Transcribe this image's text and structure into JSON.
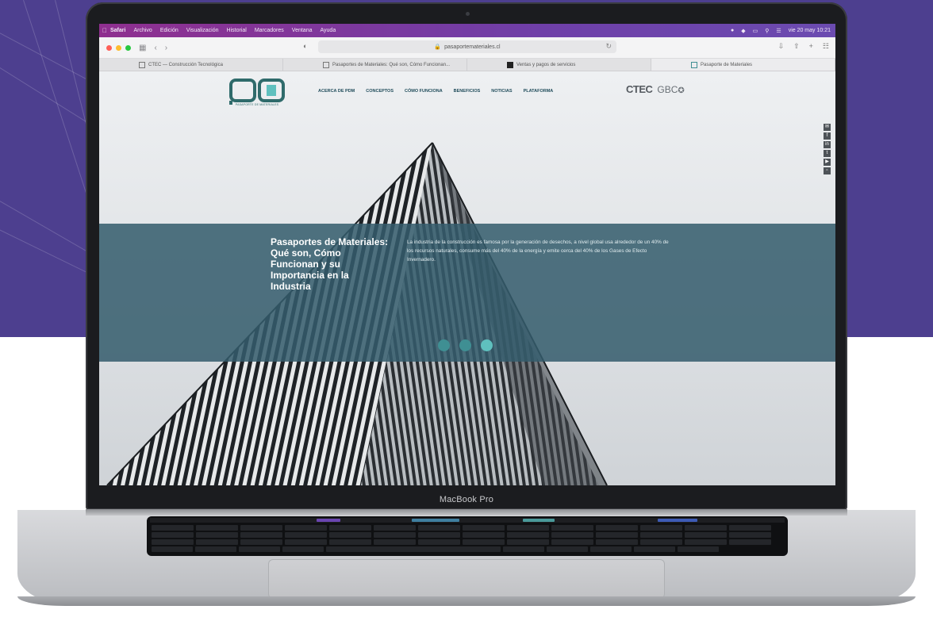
{
  "colors": {
    "background_top": "#4d3f8f",
    "menubar_gradient": [
      "#8f2f8f",
      "#6b4bb0"
    ],
    "accent_teal": "#5fc0be",
    "band": "#345c6c"
  },
  "device": {
    "label": "MacBook Pro"
  },
  "menubar": {
    "items": [
      "Safari",
      "Archivo",
      "Edición",
      "Visualización",
      "Historial",
      "Marcadores",
      "Ventana",
      "Ayuda"
    ],
    "clock": "vie 20 may 10:21"
  },
  "browser": {
    "url": "pasaportemateriales.cl",
    "tabs": [
      {
        "label": "CTEC — Construcción Tecnológica"
      },
      {
        "label": "Pasaportes de Materiales: Qué son, Cómo Funcionan..."
      },
      {
        "label": "Ventas y pagos de servicios"
      },
      {
        "label": "Pasaporte de Materiales"
      }
    ]
  },
  "site": {
    "logo_subtitle": "PASAPORTE DE MATERIALES",
    "nav": [
      "ACERCA DE PDM",
      "CONCEPTOS",
      "CÓMO FUNCIONA",
      "BENEFICIOS",
      "NOTICIAS",
      "PLATAFORMA"
    ],
    "partners": [
      "CTEC",
      "GBC"
    ],
    "social_icons": [
      "mail-icon",
      "facebook-icon",
      "linkedin-icon",
      "twitter-icon",
      "youtube-icon",
      "email-icon"
    ],
    "hero": {
      "title": "Pasaportes de Materiales: Qué son, Cómo Funcionan y su Importancia en la Industria",
      "text": "La industria de la construcción es famosa por la generación de desechos, a nivel global usa alrededor de un 40% de los recursos naturales, consume más del 40% de la energía y emite cerca del 40% de los Gases de Efecto Invernadero.",
      "slides": 3,
      "active_slide": 3
    }
  }
}
